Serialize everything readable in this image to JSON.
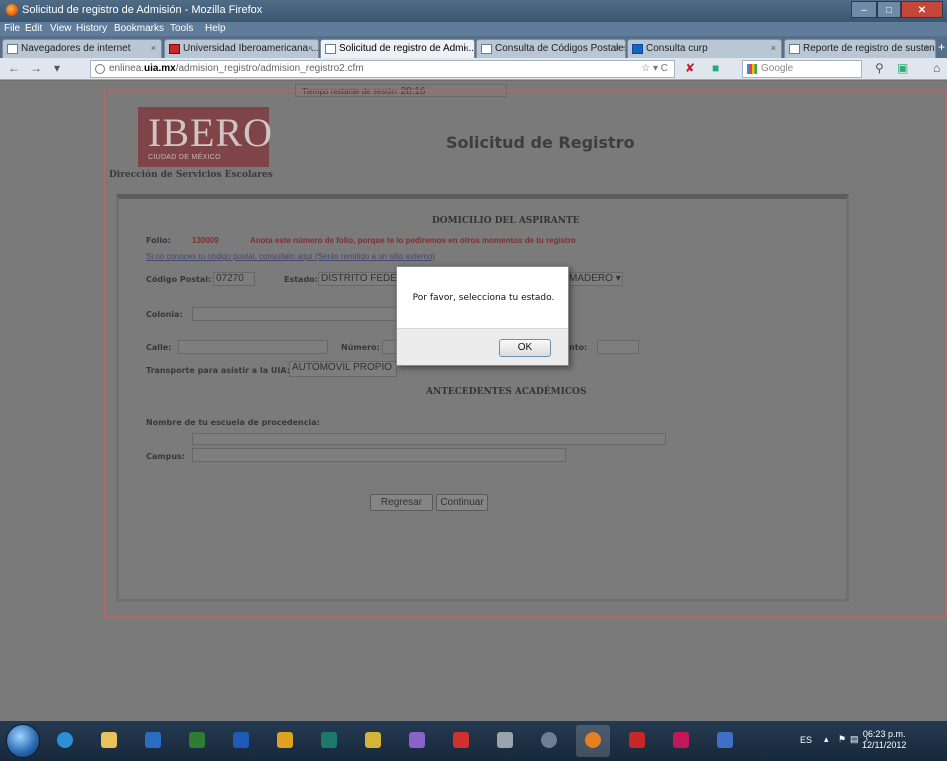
{
  "window": {
    "title": "Solicitud de registro de Admisión - Mozilla Firefox",
    "menu": [
      "File",
      "Edit",
      "View",
      "History",
      "Bookmarks",
      "Tools",
      "Help"
    ]
  },
  "tabs": [
    {
      "label": "Navegadores de internet"
    },
    {
      "label": "Universidad Iberoamericana ..."
    },
    {
      "label": "Solicitud de registro de Admi..."
    },
    {
      "label": "Consulta de Códigos Postales"
    },
    {
      "label": "Consulta curp"
    },
    {
      "label": "Reporte de registro de susten..."
    }
  ],
  "nav": {
    "url_prefix": "enlinea.",
    "url_domain": "uia.mx",
    "url_path": "/admision_registro/admision_registro2.cfm",
    "search_placeholder": "Google"
  },
  "page": {
    "session_label": "Tiempo restante de sesión:",
    "session_value": "28:16",
    "logo_text": "IBERO",
    "logo_subtext": "CIUDAD DE MÉXICO",
    "logo_caption": "Dirección de Servicios Escolares",
    "title": "Solicitud de Registro"
  },
  "form": {
    "section_domicilio": "DOMICILIO DEL ASPIRANTE",
    "folio_label": "Folio:",
    "folio_value": "130009",
    "folio_note": "Anota este número de folio, porque te lo pediremos en otros momentos de tu registro",
    "cp_link": "Si no conoces tu código postal, consultalo aquí (Serás remitido a un sitio externo)",
    "cp_label": "Código Postal:",
    "cp_value": "07270",
    "estado_label": "Estado:",
    "estado_value": "DISTRITO FEDE",
    "municipio_value": "MADERO",
    "colonia_label": "Colonia:",
    "calle_label": "Calle:",
    "numero_label": "Número:",
    "depto_label": "nto:",
    "transporte_label": "Transporte para asistir a la UIA:",
    "transporte_value": "AUTOMOVIL PROPIO",
    "section_academicos": "ANTECEDENTES ACADÉMICOS",
    "escuela_label": "Nombre de tu escuela de procedencia:",
    "campus_label": "Campus:",
    "regresar_label": "Regresar",
    "continuar_label": "Continuar"
  },
  "dialog": {
    "message": "Por favor, selecciona tu estado.",
    "ok_label": "OK"
  },
  "taskbar": {
    "lang": "ES",
    "time": "06:23 p.m.",
    "date": "12/11/2012"
  }
}
